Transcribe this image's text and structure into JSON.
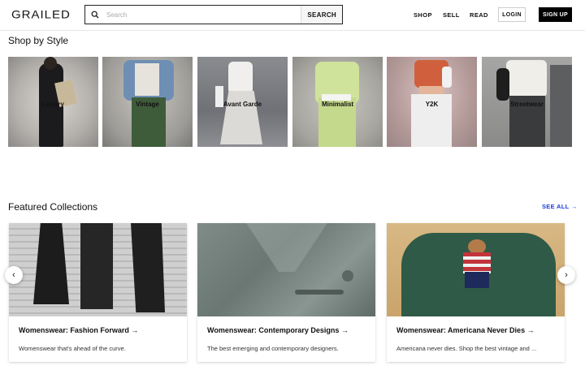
{
  "header": {
    "logo": "GRAILED",
    "search_placeholder": "Search",
    "search_button": "SEARCH",
    "nav": [
      "SHOP",
      "SELL",
      "READ"
    ],
    "login": "LOGIN",
    "signup": "SIGN UP"
  },
  "shop_by_style": {
    "title": "Shop by Style",
    "items": [
      {
        "label": "Luxury"
      },
      {
        "label": "Vintage"
      },
      {
        "label": "Avant Garde"
      },
      {
        "label": "Minimalist"
      },
      {
        "label": "Y2K"
      },
      {
        "label": "Streetwear"
      }
    ]
  },
  "featured": {
    "title": "Featured Collections",
    "see_all": "SEE ALL →",
    "cards": [
      {
        "title": "Womenswear: Fashion Forward →",
        "desc": "Womenswear that's ahead of the curve."
      },
      {
        "title": "Womenswear: Contemporary Designs →",
        "desc": "The best emerging and contemporary designers."
      },
      {
        "title": "Womenswear: Americana Never Dies →",
        "desc": "Americana never dies. Shop the best vintage and ..."
      }
    ],
    "prev": "‹",
    "next": "›"
  },
  "colors": {
    "accent_link": "#1a3ed6",
    "signup_bg": "#000000"
  }
}
